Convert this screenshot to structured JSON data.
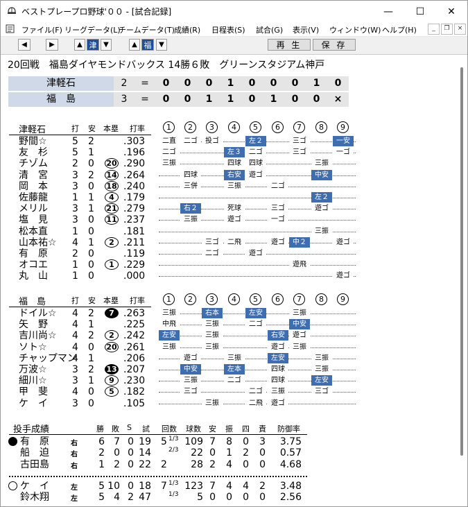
{
  "window": {
    "title": "ベストプレープロ野球'００ - [試合記録]",
    "minimize_glyph": "—",
    "maximize_glyph": "☐",
    "close_glyph": "✕"
  },
  "menu": [
    "ファイル(F)",
    "リーグデータ(L)",
    "チームデータ(T)",
    "成績(R)",
    "日程表(S)",
    "試合(G)",
    "表示(V)",
    "ウィンドウ(W)",
    "ヘルプ(H)"
  ],
  "mdi": {
    "minimize": "_",
    "restore": "❐",
    "close": "×"
  },
  "toolbar": {
    "prev_glyph": "◀",
    "next_glyph": "▶",
    "up_glyph": "▲",
    "down_glyph": "▼",
    "away_flag": "津",
    "home_flag": "福",
    "play_label": "再 生",
    "save_label": "保 存"
  },
  "game": {
    "header": "20回戦　福島ダイヤモンドバックス 14勝６敗　グリーンスタジアム神戸"
  },
  "linescore": [
    {
      "team": "津軽石",
      "score": "2",
      "eq": "=",
      "innings": [
        "0",
        "0",
        "0",
        "1",
        "0",
        "0",
        "0",
        "1",
        "0"
      ]
    },
    {
      "team": "福　島",
      "score": "3",
      "eq": "=",
      "innings": [
        "0",
        "0",
        "1",
        "1",
        "0",
        "1",
        "0",
        "0",
        "×"
      ]
    }
  ],
  "batting_columns": {
    "ab": "打",
    "h": "安",
    "hr": "本塁",
    "avg": "打率"
  },
  "inning_labels": [
    "1",
    "2",
    "3",
    "4",
    "5",
    "6",
    "7",
    "8",
    "9"
  ],
  "away_batting": {
    "team": "津軽石",
    "rows": [
      {
        "name": "野間☆",
        "ab": "5",
        "h": "2",
        "hr": "",
        "avg": ".303",
        "res": [
          [
            "二直",
            0
          ],
          [
            "二ゴ",
            0
          ],
          [
            "投ゴ",
            0
          ],
          [
            "",
            0
          ],
          [
            "左２",
            1
          ],
          [
            "",
            0
          ],
          [
            "三ゴ",
            0
          ],
          [
            "",
            0
          ],
          [
            "一安",
            1
          ]
        ]
      },
      {
        "name": "友　杉",
        "ab": "5",
        "h": "1",
        "hr": "",
        "avg": ".196",
        "res": [
          [
            "二ゴ",
            0
          ],
          [
            "",
            0
          ],
          [
            "",
            0
          ],
          [
            "左３",
            1
          ],
          [
            "二ゴ",
            0
          ],
          [
            "",
            0
          ],
          [
            "三ゴ",
            0
          ],
          [
            "",
            0
          ],
          [
            "一ゴ",
            0
          ]
        ]
      },
      {
        "name": "チゾム",
        "ab": "2",
        "h": "0",
        "hr": "20",
        "avg": ".290",
        "res": [
          [
            "三振",
            0
          ],
          [
            "",
            0
          ],
          [
            "",
            0
          ],
          [
            "四球",
            0
          ],
          [
            "四球",
            0
          ],
          [
            "",
            0
          ],
          [
            "",
            0
          ],
          [
            "三振",
            0
          ],
          [
            "",
            0
          ]
        ]
      },
      {
        "name": "清　宮",
        "ab": "3",
        "h": "2",
        "hr": "14",
        "avg": ".264",
        "res": [
          [
            "",
            0
          ],
          [
            "四球",
            0
          ],
          [
            "",
            0
          ],
          [
            "右安",
            1
          ],
          [
            "遊ゴ",
            0
          ],
          [
            "",
            0
          ],
          [
            "",
            0
          ],
          [
            "中安",
            1
          ],
          [
            "",
            0
          ]
        ]
      },
      {
        "name": "岡　本",
        "ab": "3",
        "h": "0",
        "hr": "18",
        "avg": ".240",
        "res": [
          [
            "",
            0
          ],
          [
            "三併",
            0
          ],
          [
            "",
            0
          ],
          [
            "三振",
            0
          ],
          [
            "",
            0
          ],
          [
            "二ゴ",
            0
          ],
          [
            "",
            0
          ],
          [
            "",
            0
          ],
          [
            "",
            0
          ]
        ]
      },
      {
        "name": "佐藤龍",
        "ab": "1",
        "h": "1",
        "hr": "4",
        "avg": ".179",
        "res": [
          [
            "",
            0
          ],
          [
            "",
            0
          ],
          [
            "",
            0
          ],
          [
            "",
            0
          ],
          [
            "",
            0
          ],
          [
            "",
            0
          ],
          [
            "",
            0
          ],
          [
            "左２",
            1
          ],
          [
            "",
            0
          ]
        ]
      },
      {
        "name": "メリル",
        "ab": "3",
        "h": "1",
        "hr": "21",
        "avg": ".279",
        "res": [
          [
            "",
            0
          ],
          [
            "右２",
            1
          ],
          [
            "",
            0
          ],
          [
            "死球",
            0
          ],
          [
            "",
            0
          ],
          [
            "三ゴ",
            0
          ],
          [
            "",
            0
          ],
          [
            "遊ゴ",
            0
          ],
          [
            "",
            0
          ]
        ]
      },
      {
        "name": "塩　見",
        "ab": "3",
        "h": "0",
        "hr": "11",
        "avg": ".237",
        "res": [
          [
            "",
            0
          ],
          [
            "三振",
            0
          ],
          [
            "",
            0
          ],
          [
            "遊ゴ",
            0
          ],
          [
            "",
            0
          ],
          [
            "一ゴ",
            0
          ],
          [
            "",
            0
          ],
          [
            "",
            0
          ],
          [
            "",
            0
          ]
        ]
      },
      {
        "name": "松本直",
        "ab": "1",
        "h": "0",
        "hr": "",
        "avg": ".181",
        "res": [
          [
            "",
            0
          ],
          [
            "",
            0
          ],
          [
            "",
            0
          ],
          [
            "",
            0
          ],
          [
            "",
            0
          ],
          [
            "",
            0
          ],
          [
            "",
            0
          ],
          [
            "三振",
            0
          ],
          [
            "",
            0
          ]
        ]
      },
      {
        "name": "山本祐☆",
        "ab": "4",
        "h": "1",
        "hr": "2",
        "avg": ".211",
        "res": [
          [
            "",
            0
          ],
          [
            "",
            0
          ],
          [
            "三ゴ",
            0
          ],
          [
            "二飛",
            0
          ],
          [
            "",
            0
          ],
          [
            "遊ゴ",
            0
          ],
          [
            "中２",
            1
          ],
          [
            "",
            0
          ],
          [
            "遊ゴ",
            0
          ]
        ]
      },
      {
        "name": "有　原",
        "ab": "2",
        "h": "0",
        "hr": "",
        "avg": ".119",
        "res": [
          [
            "",
            0
          ],
          [
            "",
            0
          ],
          [
            "二ゴ",
            0
          ],
          [
            "",
            0
          ],
          [
            "遊ゴ",
            0
          ],
          [
            "",
            0
          ],
          [
            "",
            0
          ],
          [
            "",
            0
          ],
          [
            "",
            0
          ]
        ]
      },
      {
        "name": "オコエ",
        "ab": "1",
        "h": "0",
        "hr": "1",
        "avg": ".229",
        "res": [
          [
            "",
            0
          ],
          [
            "",
            0
          ],
          [
            "",
            0
          ],
          [
            "",
            0
          ],
          [
            "",
            0
          ],
          [
            "",
            0
          ],
          [
            "遊飛",
            0
          ],
          [
            "",
            0
          ],
          [
            "",
            0
          ]
        ]
      },
      {
        "name": "丸　山",
        "ab": "1",
        "h": "0",
        "hr": "",
        "avg": ".000",
        "res": [
          [
            "",
            0
          ],
          [
            "",
            0
          ],
          [
            "",
            0
          ],
          [
            "",
            0
          ],
          [
            "",
            0
          ],
          [
            "",
            0
          ],
          [
            "",
            0
          ],
          [
            "",
            0
          ],
          [
            "遊ゴ",
            0
          ]
        ]
      }
    ]
  },
  "home_batting": {
    "team": "福　島",
    "rows": [
      {
        "name": "ドイル☆",
        "ab": "4",
        "h": "2",
        "hr": "7",
        "hr_filled": true,
        "avg": ".263",
        "res": [
          [
            "三振",
            0
          ],
          [
            "",
            0
          ],
          [
            "右本",
            1
          ],
          [
            "",
            0
          ],
          [
            "左安",
            1
          ],
          [
            "",
            0
          ],
          [
            "三振",
            0
          ],
          [
            "",
            0
          ],
          [
            "",
            0
          ]
        ]
      },
      {
        "name": "矢　野",
        "ab": "4",
        "h": "1",
        "hr": "",
        "avg": ".225",
        "res": [
          [
            "中飛",
            0
          ],
          [
            "",
            0
          ],
          [
            "三振",
            0
          ],
          [
            "",
            0
          ],
          [
            "二ゴ",
            0
          ],
          [
            "",
            0
          ],
          [
            "中安",
            1
          ],
          [
            "",
            0
          ],
          [
            "",
            0
          ]
        ]
      },
      {
        "name": "吉川尚☆",
        "ab": "4",
        "h": "2",
        "hr": "2",
        "avg": ".242",
        "res": [
          [
            "左安",
            1
          ],
          [
            "",
            0
          ],
          [
            "三振",
            0
          ],
          [
            "",
            0
          ],
          [
            "",
            0
          ],
          [
            "右安",
            1
          ],
          [
            "遊ゴ",
            0
          ],
          [
            "",
            0
          ],
          [
            "",
            0
          ]
        ]
      },
      {
        "name": "ソト☆",
        "ab": "4",
        "h": "0",
        "hr": "20",
        "avg": ".261",
        "res": [
          [
            "三振",
            0
          ],
          [
            "",
            0
          ],
          [
            "三振",
            0
          ],
          [
            "",
            0
          ],
          [
            "",
            0
          ],
          [
            "遊ゴ",
            0
          ],
          [
            "三振",
            0
          ],
          [
            "",
            0
          ],
          [
            "",
            0
          ]
        ]
      },
      {
        "name": "チャップマン",
        "ab": "4",
        "h": "1",
        "hr": "",
        "avg": ".206",
        "res": [
          [
            "",
            0
          ],
          [
            "遊ゴ",
            0
          ],
          [
            "",
            0
          ],
          [
            "三振",
            0
          ],
          [
            "",
            0
          ],
          [
            "左安",
            1
          ],
          [
            "",
            0
          ],
          [
            "三振",
            0
          ],
          [
            "",
            0
          ]
        ]
      },
      {
        "name": "万波☆",
        "ab": "3",
        "h": "2",
        "hr": "13",
        "hr_filled": true,
        "avg": ".207",
        "res": [
          [
            "",
            0
          ],
          [
            "中安",
            1
          ],
          [
            "",
            0
          ],
          [
            "左本",
            1
          ],
          [
            "",
            0
          ],
          [
            "四球",
            0
          ],
          [
            "",
            0
          ],
          [
            "三振",
            0
          ],
          [
            "",
            0
          ]
        ]
      },
      {
        "name": "細川☆",
        "ab": "3",
        "h": "1",
        "hr": "9",
        "avg": ".230",
        "res": [
          [
            "",
            0
          ],
          [
            "三振",
            0
          ],
          [
            "",
            0
          ],
          [
            "二ゴ",
            0
          ],
          [
            "",
            0
          ],
          [
            "四球",
            0
          ],
          [
            "",
            0
          ],
          [
            "左安",
            1
          ],
          [
            "",
            0
          ]
        ]
      },
      {
        "name": "甲　斐",
        "ab": "4",
        "h": "0",
        "hr": "5",
        "avg": ".182",
        "res": [
          [
            "",
            0
          ],
          [
            "三ゴ",
            0
          ],
          [
            "",
            0
          ],
          [
            "",
            0
          ],
          [
            "二ゴ",
            0
          ],
          [
            "三振",
            0
          ],
          [
            "",
            0
          ],
          [
            "三ゴ",
            0
          ],
          [
            "",
            0
          ]
        ]
      },
      {
        "name": "ケ　イ",
        "ab": "3",
        "h": "0",
        "hr": "",
        "avg": ".105",
        "res": [
          [
            "",
            0
          ],
          [
            "",
            0
          ],
          [
            "三振",
            0
          ],
          [
            "",
            0
          ],
          [
            "二飛",
            0
          ],
          [
            "遊ゴ",
            0
          ],
          [
            "",
            0
          ],
          [
            "",
            0
          ],
          [
            "",
            0
          ]
        ]
      }
    ]
  },
  "pitching": {
    "title": "投手成績",
    "columns": {
      "w": "勝",
      "l": "敗",
      "s": "S",
      "g": "試",
      "ip": "回数",
      "np": "球数",
      "h": "安",
      "so": "振",
      "bb": "四",
      "er": "責",
      "era": "防御率"
    },
    "away": [
      {
        "mark": "win",
        "name": "有　原",
        "hand": "右",
        "w": "6",
        "l": "7",
        "s": "0",
        "g": "19",
        "ip": "5",
        "ip_frac": "1/3",
        "np": "109",
        "h": "7",
        "so": "8",
        "bb": "0",
        "er": "3",
        "era": "3.75"
      },
      {
        "mark": "",
        "name": "船　迫",
        "hand": "右",
        "w": "2",
        "l": "0",
        "s": "0",
        "g": "14",
        "ip": "",
        "ip_frac": "2/3",
        "np": "22",
        "h": "0",
        "so": "1",
        "bb": "2",
        "er": "0",
        "era": "0.57"
      },
      {
        "mark": "",
        "name": "古田島",
        "hand": "右",
        "w": "1",
        "l": "2",
        "s": "0",
        "g": "22",
        "ip": "2",
        "ip_frac": "",
        "np": "28",
        "h": "2",
        "so": "4",
        "bb": "0",
        "er": "0",
        "era": "4.68"
      }
    ],
    "home": [
      {
        "mark": "loss",
        "name": "ケ　イ",
        "hand": "左",
        "w": "5",
        "l": "10",
        "s": "0",
        "g": "18",
        "ip": "7",
        "ip_frac": "1/3",
        "np": "123",
        "h": "7",
        "so": "4",
        "bb": "4",
        "er": "2",
        "era": "3.48"
      },
      {
        "mark": "",
        "name": "鈴木翔",
        "hand": "左",
        "w": "5",
        "l": "4",
        "s": "2",
        "g": "47",
        "ip": "",
        "ip_frac": "1/3",
        "np": "5",
        "h": "0",
        "so": "0",
        "bb": "0",
        "er": "0",
        "era": "2.56"
      }
    ]
  }
}
